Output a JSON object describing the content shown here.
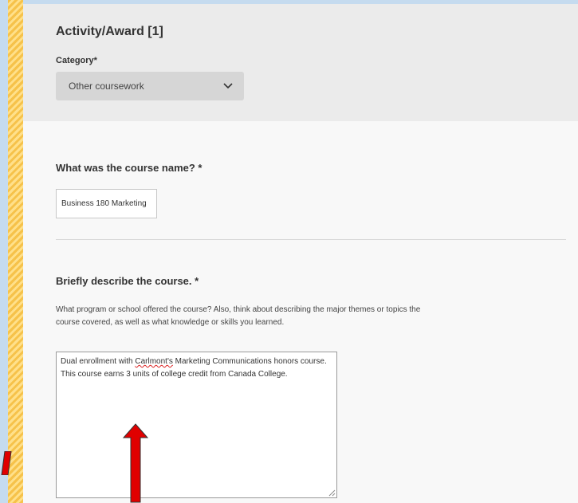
{
  "activity": {
    "title": "Activity/Award [1]",
    "category_label": "Category*",
    "category_value": "Other coursework"
  },
  "course_name": {
    "question": "What was the course name? *",
    "value": "Business 180 Marketing"
  },
  "course_description": {
    "question": "Briefly describe the course. *",
    "help_text": "What program or school offered the course? Also, think about describing the major themes or topics the course covered, as well as what knowledge or skills you learned.",
    "value_part1": "Dual enrollment with ",
    "value_misspelled": "Carlmont's",
    "value_part2": " Marketing Communications honors course.  This course earns 3 units of college credit from Canada College."
  },
  "colors": {
    "annotation_arrow": "#e00000",
    "stripe": "#f6c24a",
    "header_bg": "#ebebeb"
  }
}
